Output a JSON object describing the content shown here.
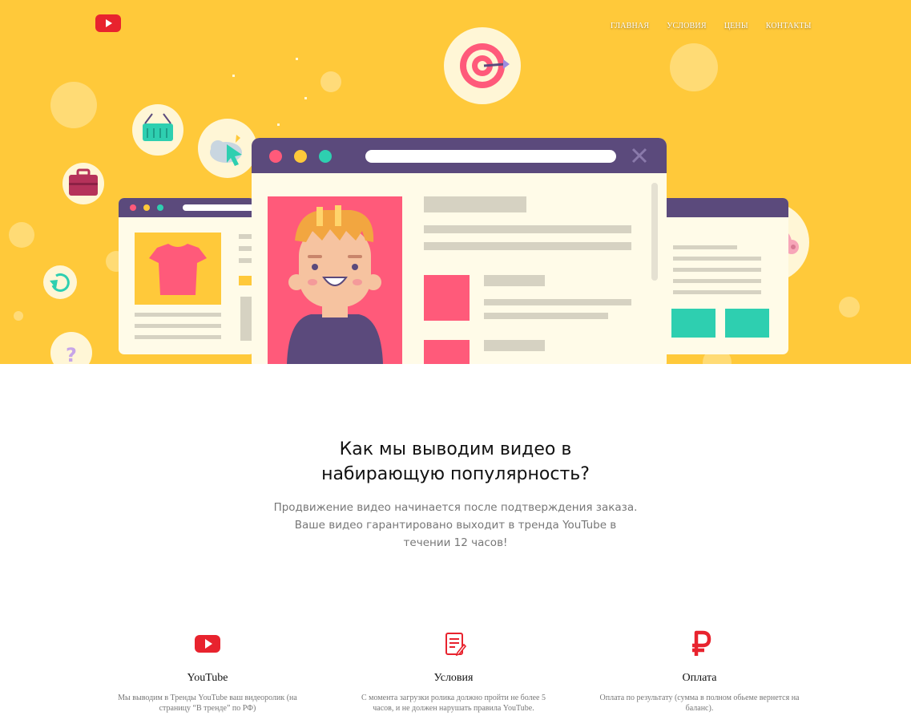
{
  "nav": {
    "items": [
      "ГЛАВНАЯ",
      "УСЛОВИЯ",
      "ЦЕНЫ",
      "КОНТАКТЫ"
    ]
  },
  "icons": {
    "logo": "youtube-logo-icon",
    "hero": [
      "target-icon",
      "basket-icon",
      "cursor-cloud-icon",
      "briefcase-icon",
      "refresh-icon",
      "question-icon",
      "piggy-bank-icon"
    ]
  },
  "colors": {
    "hero_background": "#ffc93a",
    "brand_red": "#e8232e",
    "browser_bar": "#5b4a7c",
    "accent_pink": "#ff5a7a",
    "accent_teal": "#2ecfb0"
  },
  "section": {
    "title_line1": "Как мы выводим видео в",
    "title_line2": "набирающую популярность?",
    "sub_line1": "Продвижение видео начинается после подтверждения заказа.",
    "sub_line2": "Ваше видео гарантировано выходит в тренда YouTube в",
    "sub_line3": "течении 12 часов!"
  },
  "features": [
    {
      "icon": "youtube-icon",
      "title": "YouTube",
      "desc_line1": "Мы выводим в Тренды YouTube ваш видеоролик (на",
      "desc_line2": "страницу “В тренде” по РФ)"
    },
    {
      "icon": "document-edit-icon",
      "title": "Условия",
      "desc_line1": "С момента загрузки ролика должно пройти не более 5",
      "desc_line2": "часов, и не должен нарушать правила YouTube."
    },
    {
      "icon": "ruble-icon",
      "title": "Оплата",
      "desc_line1": "Оплата по результату (сумма в полном обьеме вернется на",
      "desc_line2": "баланс)."
    }
  ]
}
